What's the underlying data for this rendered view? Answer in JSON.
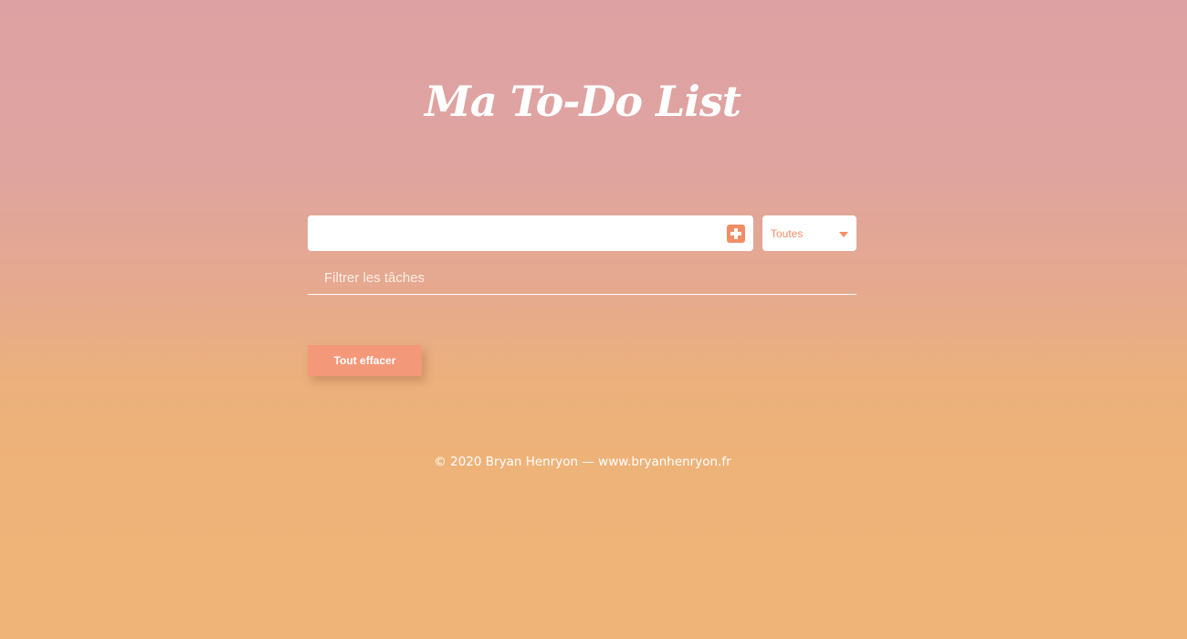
{
  "header": {
    "title": "Ma To-Do List"
  },
  "add_task": {
    "value": "",
    "placeholder": "",
    "add_icon": "plus-square-icon"
  },
  "filter_select": {
    "selected": "Toutes",
    "icon": "chevron-down-icon"
  },
  "filter_input": {
    "placeholder": "Filtrer les tâches",
    "value": ""
  },
  "actions": {
    "clear_all_label": "Tout effacer"
  },
  "footer": {
    "text": "© 2020 Bryan Henryon — www.bryanhenryon.fr"
  },
  "colors": {
    "accent": "#f28e66",
    "button": "#f4987a",
    "background_top": "#dea1a3",
    "background_bottom": "#efb478"
  }
}
